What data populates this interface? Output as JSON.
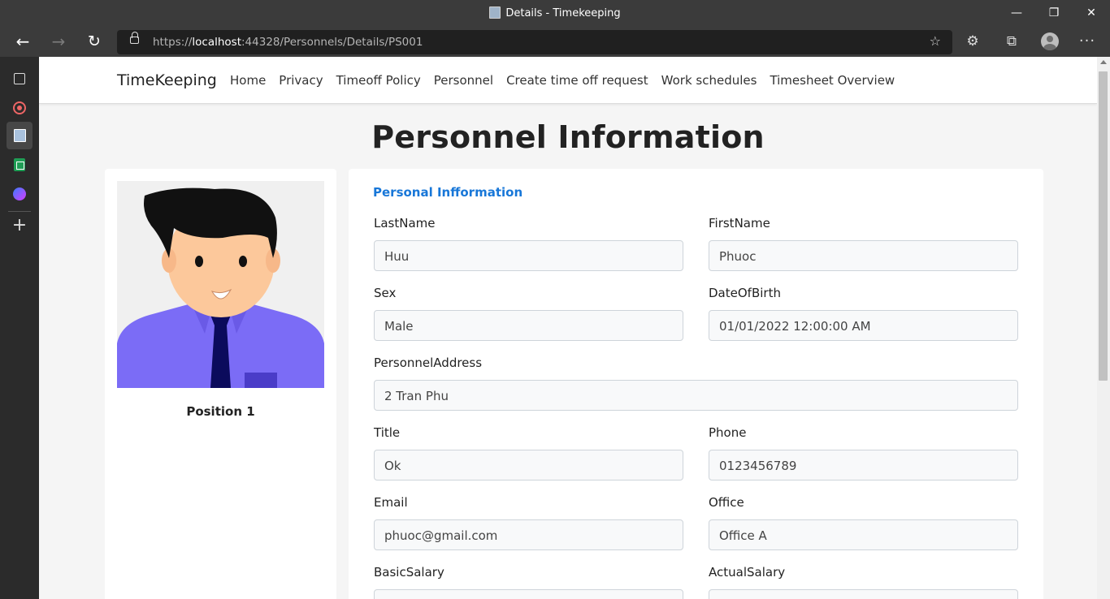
{
  "window": {
    "title": "Details - Timekeeping",
    "min_glyph": "—",
    "max_glyph": "❐",
    "close_glyph": "✕"
  },
  "toolbar": {
    "back_glyph": "←",
    "forward_glyph": "→",
    "refresh_glyph": "↻",
    "url_prefix": "https://",
    "url_host": "localhost",
    "url_rest": ":44328/Personnels/Details/PS001",
    "favorite_glyph": "☆",
    "extensions_glyph": "⚙",
    "collections_glyph": "⧉",
    "more_glyph": "···"
  },
  "sidebar": {
    "add_glyph": "+"
  },
  "navbar": {
    "brand": "TimeKeeping",
    "links": [
      "Home",
      "Privacy",
      "Timeoff Policy",
      "Personnel",
      "Create time off request",
      "Work schedules",
      "Timesheet Overview"
    ]
  },
  "page": {
    "title": "Personnel Information"
  },
  "profile": {
    "position": "Position 1"
  },
  "details": {
    "section_title": "Personal Infformation",
    "fields": {
      "last_name": {
        "label": "LastName",
        "value": "Huu"
      },
      "first_name": {
        "label": "FirstName",
        "value": "Phuoc"
      },
      "sex": {
        "label": "Sex",
        "value": "Male"
      },
      "date_of_birth": {
        "label": "DateOfBirth",
        "value": "01/01/2022 12:00:00 AM"
      },
      "address": {
        "label": "PersonnelAddress",
        "value": "2 Tran Phu"
      },
      "title": {
        "label": "Title",
        "value": "Ok"
      },
      "phone": {
        "label": "Phone",
        "value": "0123456789"
      },
      "email": {
        "label": "Email",
        "value": "phuoc@gmail.com"
      },
      "office": {
        "label": "Office",
        "value": "Office A"
      },
      "basic_salary": {
        "label": "BasicSalary",
        "value": ""
      },
      "actual_salary": {
        "label": "ActualSalary",
        "value": ""
      }
    }
  },
  "colors": {
    "accent": "#1877d8",
    "shirt": "#7b6cf6",
    "tie": "#0b0b5c",
    "skin": "#fcc89b"
  }
}
